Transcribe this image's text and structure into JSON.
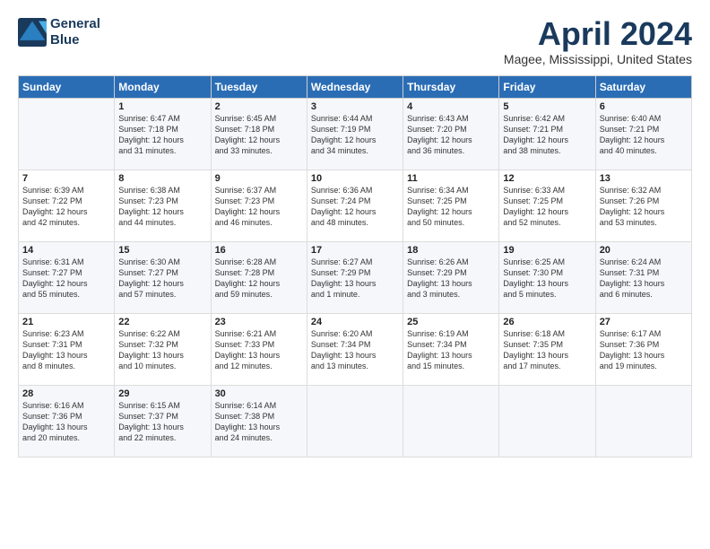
{
  "logo": {
    "line1": "General",
    "line2": "Blue"
  },
  "title": "April 2024",
  "location": "Magee, Mississippi, United States",
  "days_of_week": [
    "Sunday",
    "Monday",
    "Tuesday",
    "Wednesday",
    "Thursday",
    "Friday",
    "Saturday"
  ],
  "weeks": [
    [
      {
        "day": "",
        "content": ""
      },
      {
        "day": "1",
        "content": "Sunrise: 6:47 AM\nSunset: 7:18 PM\nDaylight: 12 hours\nand 31 minutes."
      },
      {
        "day": "2",
        "content": "Sunrise: 6:45 AM\nSunset: 7:18 PM\nDaylight: 12 hours\nand 33 minutes."
      },
      {
        "day": "3",
        "content": "Sunrise: 6:44 AM\nSunset: 7:19 PM\nDaylight: 12 hours\nand 34 minutes."
      },
      {
        "day": "4",
        "content": "Sunrise: 6:43 AM\nSunset: 7:20 PM\nDaylight: 12 hours\nand 36 minutes."
      },
      {
        "day": "5",
        "content": "Sunrise: 6:42 AM\nSunset: 7:21 PM\nDaylight: 12 hours\nand 38 minutes."
      },
      {
        "day": "6",
        "content": "Sunrise: 6:40 AM\nSunset: 7:21 PM\nDaylight: 12 hours\nand 40 minutes."
      }
    ],
    [
      {
        "day": "7",
        "content": "Sunrise: 6:39 AM\nSunset: 7:22 PM\nDaylight: 12 hours\nand 42 minutes."
      },
      {
        "day": "8",
        "content": "Sunrise: 6:38 AM\nSunset: 7:23 PM\nDaylight: 12 hours\nand 44 minutes."
      },
      {
        "day": "9",
        "content": "Sunrise: 6:37 AM\nSunset: 7:23 PM\nDaylight: 12 hours\nand 46 minutes."
      },
      {
        "day": "10",
        "content": "Sunrise: 6:36 AM\nSunset: 7:24 PM\nDaylight: 12 hours\nand 48 minutes."
      },
      {
        "day": "11",
        "content": "Sunrise: 6:34 AM\nSunset: 7:25 PM\nDaylight: 12 hours\nand 50 minutes."
      },
      {
        "day": "12",
        "content": "Sunrise: 6:33 AM\nSunset: 7:25 PM\nDaylight: 12 hours\nand 52 minutes."
      },
      {
        "day": "13",
        "content": "Sunrise: 6:32 AM\nSunset: 7:26 PM\nDaylight: 12 hours\nand 53 minutes."
      }
    ],
    [
      {
        "day": "14",
        "content": "Sunrise: 6:31 AM\nSunset: 7:27 PM\nDaylight: 12 hours\nand 55 minutes."
      },
      {
        "day": "15",
        "content": "Sunrise: 6:30 AM\nSunset: 7:27 PM\nDaylight: 12 hours\nand 57 minutes."
      },
      {
        "day": "16",
        "content": "Sunrise: 6:28 AM\nSunset: 7:28 PM\nDaylight: 12 hours\nand 59 minutes."
      },
      {
        "day": "17",
        "content": "Sunrise: 6:27 AM\nSunset: 7:29 PM\nDaylight: 13 hours\nand 1 minute."
      },
      {
        "day": "18",
        "content": "Sunrise: 6:26 AM\nSunset: 7:29 PM\nDaylight: 13 hours\nand 3 minutes."
      },
      {
        "day": "19",
        "content": "Sunrise: 6:25 AM\nSunset: 7:30 PM\nDaylight: 13 hours\nand 5 minutes."
      },
      {
        "day": "20",
        "content": "Sunrise: 6:24 AM\nSunset: 7:31 PM\nDaylight: 13 hours\nand 6 minutes."
      }
    ],
    [
      {
        "day": "21",
        "content": "Sunrise: 6:23 AM\nSunset: 7:31 PM\nDaylight: 13 hours\nand 8 minutes."
      },
      {
        "day": "22",
        "content": "Sunrise: 6:22 AM\nSunset: 7:32 PM\nDaylight: 13 hours\nand 10 minutes."
      },
      {
        "day": "23",
        "content": "Sunrise: 6:21 AM\nSunset: 7:33 PM\nDaylight: 13 hours\nand 12 minutes."
      },
      {
        "day": "24",
        "content": "Sunrise: 6:20 AM\nSunset: 7:34 PM\nDaylight: 13 hours\nand 13 minutes."
      },
      {
        "day": "25",
        "content": "Sunrise: 6:19 AM\nSunset: 7:34 PM\nDaylight: 13 hours\nand 15 minutes."
      },
      {
        "day": "26",
        "content": "Sunrise: 6:18 AM\nSunset: 7:35 PM\nDaylight: 13 hours\nand 17 minutes."
      },
      {
        "day": "27",
        "content": "Sunrise: 6:17 AM\nSunset: 7:36 PM\nDaylight: 13 hours\nand 19 minutes."
      }
    ],
    [
      {
        "day": "28",
        "content": "Sunrise: 6:16 AM\nSunset: 7:36 PM\nDaylight: 13 hours\nand 20 minutes."
      },
      {
        "day": "29",
        "content": "Sunrise: 6:15 AM\nSunset: 7:37 PM\nDaylight: 13 hours\nand 22 minutes."
      },
      {
        "day": "30",
        "content": "Sunrise: 6:14 AM\nSunset: 7:38 PM\nDaylight: 13 hours\nand 24 minutes."
      },
      {
        "day": "",
        "content": ""
      },
      {
        "day": "",
        "content": ""
      },
      {
        "day": "",
        "content": ""
      },
      {
        "day": "",
        "content": ""
      }
    ]
  ]
}
